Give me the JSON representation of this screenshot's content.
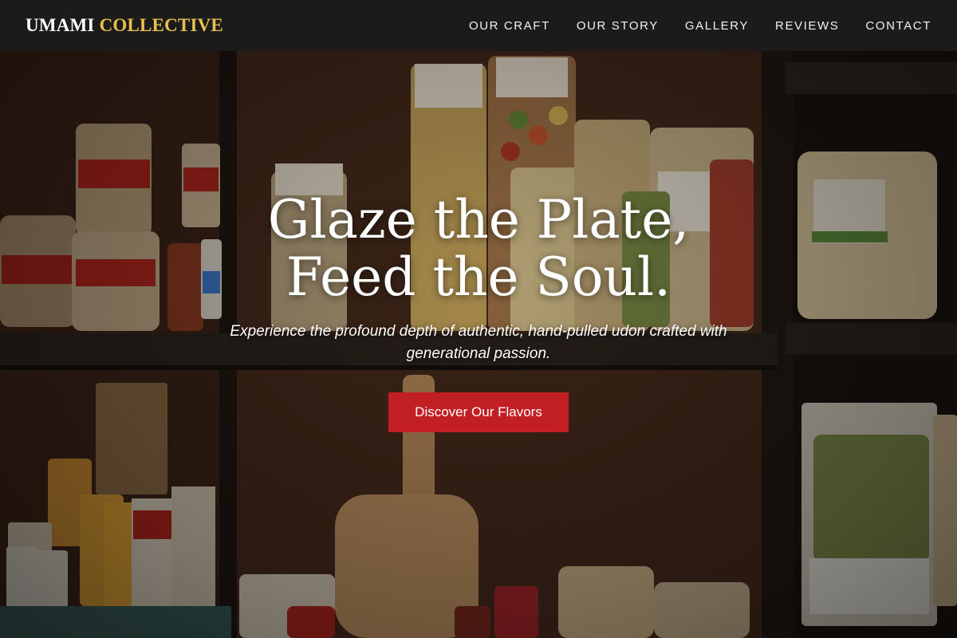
{
  "brand": {
    "primary": "UMAMI",
    "accent": "COLLECTIVE",
    "accent_color": "#e7c04f"
  },
  "nav": {
    "items": [
      {
        "label": "OUR CRAFT"
      },
      {
        "label": "OUR STORY"
      },
      {
        "label": "GALLERY"
      },
      {
        "label": "REVIEWS"
      },
      {
        "label": "CONTACT"
      }
    ]
  },
  "hero": {
    "headline_line1": "Glaze the Plate,",
    "headline_line2": "Feed the Soul.",
    "subheadline": "Experience the profound depth of authentic, hand-pulled udon crafted with generational passion.",
    "cta_label": "Discover Our Flavors",
    "cta_color": "#c11f24",
    "background_image": "pasta-shop-shelves-photo"
  }
}
